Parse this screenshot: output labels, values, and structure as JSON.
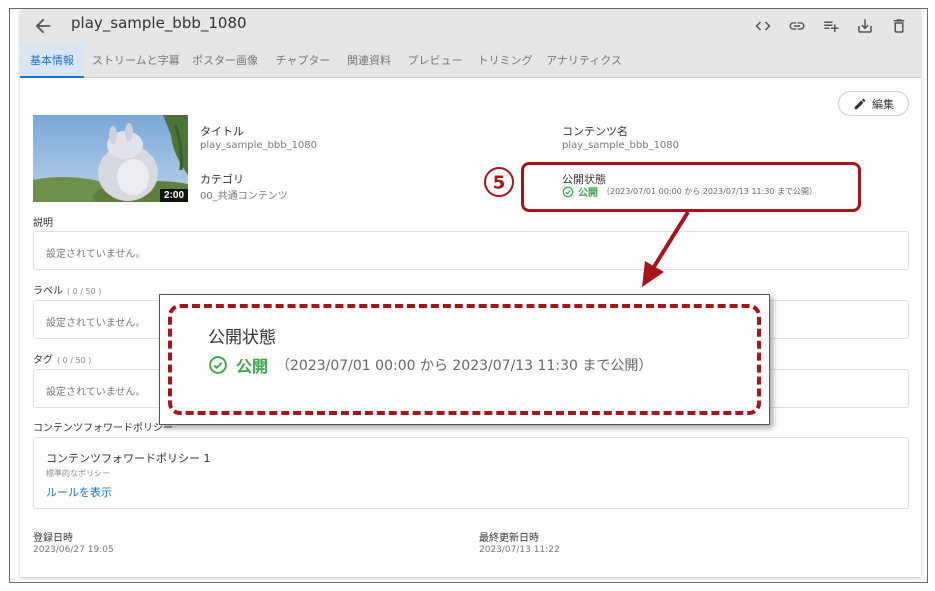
{
  "header": {
    "title": "play_sample_bbb_1080"
  },
  "tabs": [
    {
      "label": "基本情報",
      "active": true
    },
    {
      "label": "ストリームと字幕"
    },
    {
      "label": "ポスター画像"
    },
    {
      "label": "チャプター"
    },
    {
      "label": "関連資料"
    },
    {
      "label": "プレビュー"
    },
    {
      "label": "トリミング"
    },
    {
      "label": "アナリティクス"
    }
  ],
  "edit_label": "編集",
  "thumbnail": {
    "duration": "2:00"
  },
  "info": {
    "title_label": "タイトル",
    "title_value": "play_sample_bbb_1080",
    "content_name_label": "コンテンツ名",
    "content_name_value": "play_sample_bbb_1080",
    "category_label": "カテゴリ",
    "category_value": "00_共通コンテンツ",
    "publish_label": "公開状態",
    "publish_word": "公開",
    "publish_range": "（2023/07/01 00:00 から 2023/07/13 11:30 まで公開）"
  },
  "description": {
    "label": "説明",
    "placeholder": "設定されていません。"
  },
  "label_field": {
    "label": "ラベル",
    "count": "( 0 / 50 )",
    "placeholder": "設定されていません。"
  },
  "tag_field": {
    "label": "タグ",
    "count": "( 0 / 50 )",
    "placeholder": "設定されていません。"
  },
  "policy": {
    "label": "コンテンツフォワードポリシー",
    "name": "コンテンツフォワードポリシー 1",
    "sub": "標準的なポリシー",
    "link": "ルールを表示"
  },
  "dates": {
    "created_label": "登録日時",
    "created_value": "2023/06/27 19:05",
    "updated_label": "最終更新日時",
    "updated_value": "2023/07/13 11:22"
  },
  "callout": {
    "number": "5",
    "label": "公開状態",
    "word": "公開",
    "range": "（2023/07/01 00:00 から 2023/07/13 11:30 まで公開）"
  },
  "colors": {
    "accent": "#1a73c8",
    "published": "#3ea64a",
    "annotation": "#a8141c"
  },
  "icons": {
    "back": "arrow-left-icon",
    "tools": [
      "code-icon",
      "link-icon",
      "playlist-add-icon",
      "download-icon",
      "trash-icon"
    ]
  }
}
